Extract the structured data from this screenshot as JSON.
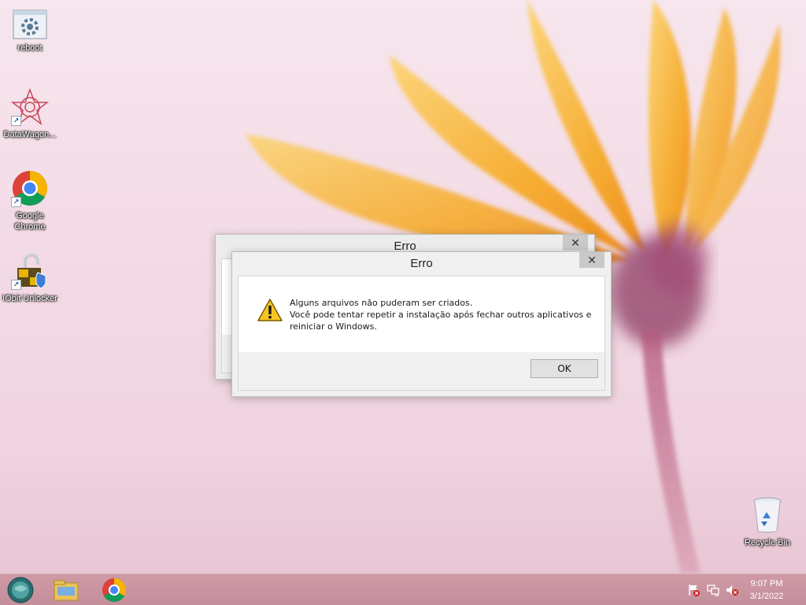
{
  "desktop": {
    "icons": [
      {
        "label": "reboot",
        "icon": "gear-window-icon"
      },
      {
        "label": "DataWagon...",
        "icon": "datawagon-star-icon"
      },
      {
        "label": "Google Chrome",
        "icon": "chrome-icon"
      },
      {
        "label": "IObit Unlocker",
        "icon": "unlock-padlock-icon"
      },
      {
        "label": "Recycle Bin",
        "icon": "recycle-bin-icon"
      }
    ]
  },
  "dialog_back": {
    "title": "Erro",
    "close": "✕"
  },
  "dialog_front": {
    "title": "Erro",
    "close": "✕",
    "message_line1": "Alguns arquivos não puderam ser criados.",
    "message_line2": "Você pode tentar repetir a instalação após fechar outros aplicativos e reiniciar o Windows.",
    "ok_label": "OK",
    "icon": "warning-icon"
  },
  "taskbar": {
    "buttons": [
      "start-orb-icon",
      "file-explorer-icon",
      "chrome-icon"
    ],
    "tray": [
      "action-center-flag-icon",
      "network-icon",
      "volume-muted-icon"
    ],
    "time": "9:07 PM",
    "date": "3/1/2022"
  },
  "colors": {
    "accent_taskbar": "#c48e9b",
    "wallpaper_petal": "#f6b23a",
    "wallpaper_bg": "#f3dbe6"
  }
}
